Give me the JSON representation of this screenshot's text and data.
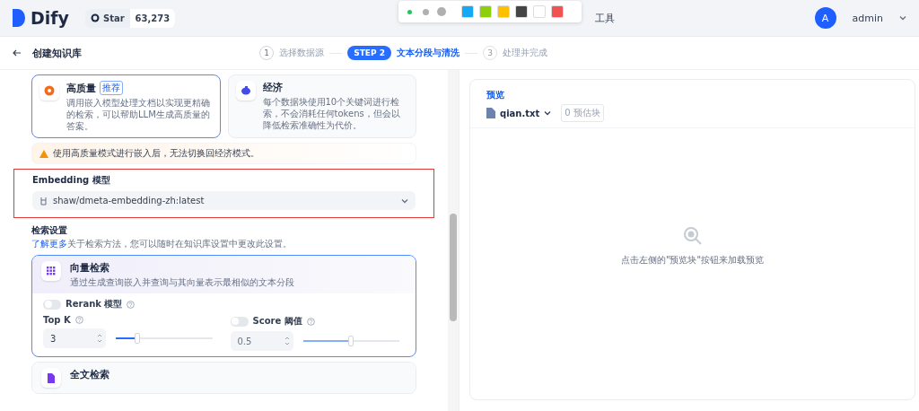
{
  "header": {
    "logo": "Dify",
    "github": {
      "label": "Star",
      "count": "63,273"
    },
    "nav": [
      {
        "label": "工具"
      }
    ],
    "user": {
      "avatar": "A",
      "name": "admin"
    }
  },
  "annotation_toolbar": {
    "dots": [
      {
        "kind": "small",
        "color": "#22c55e"
      },
      {
        "kind": "medium",
        "color": "#b0b0b0"
      },
      {
        "kind": "large",
        "color": "#b0b0b0"
      }
    ],
    "swatches": [
      {
        "color": "#14a9f5"
      },
      {
        "color": "#8ccf0a"
      },
      {
        "color": "#ffc000"
      },
      {
        "color": "#454545"
      },
      {
        "color": "#ffffff"
      },
      {
        "color": "#f25252"
      }
    ]
  },
  "page": {
    "title": "创建知识库"
  },
  "steps": [
    {
      "kind": "number",
      "number": "1",
      "label": "选择数据源",
      "selected": false
    },
    {
      "kind": "badge",
      "number": "STEP 2",
      "label": "文本分段与清洗",
      "selected": true
    },
    {
      "kind": "number",
      "number": "3",
      "label": "处理并完成",
      "selected": false
    }
  ],
  "index_modes": [
    {
      "kind": "quality",
      "title": "高质量",
      "badge": "推荐",
      "description": "调用嵌入模型处理文档以实现更精确的检索，可以帮助LLM生成高质量的答案。",
      "selected": true
    },
    {
      "kind": "economy",
      "title": "经济",
      "description": "每个数据块使用10个关键词进行检索，不会消耗任何tokens，但会以降低检索准确性为代价。",
      "selected": false
    }
  ],
  "warning": "使用高质量模式进行嵌入后，无法切换回经济模式。",
  "embedding": {
    "title": "Embedding 模型",
    "value": "shaw/dmeta-embedding-zh:latest",
    "highlighted": true
  },
  "retrieval": {
    "title": "检索设置",
    "link": "了解更多",
    "description": "关于检索方法，您可以随时在知识库设置中更改此设置。",
    "methods": [
      {
        "kind": "vector",
        "title": "向量检索",
        "description": "通过生成查询嵌入并查询与其向量表示最相似的文本分段",
        "selected": true,
        "rerank": {
          "label": "Rerank 模型",
          "on": false
        },
        "top_k": {
          "label": "Top K",
          "value": "3",
          "level": 0.22
        },
        "score": {
          "label": "Score 阈值",
          "on": false,
          "value": "0.5",
          "level": 0.5
        }
      },
      {
        "kind": "fulltext",
        "title": "全文检索",
        "selected": false
      }
    ]
  },
  "preview": {
    "label": "预览",
    "file": "qian.txt",
    "badge": "0 预估块",
    "empty": "点击左侧的\"预览块\"按钮来加载预览"
  }
}
